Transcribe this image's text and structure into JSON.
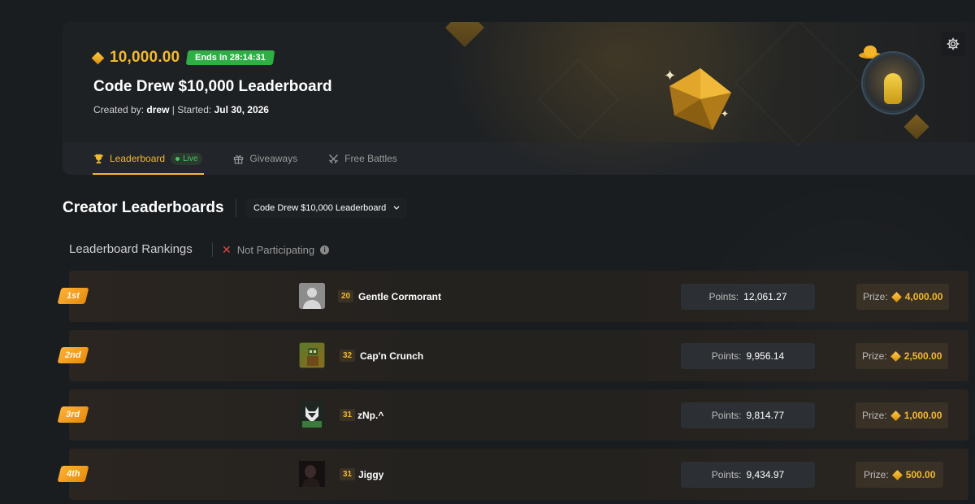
{
  "hero": {
    "prize_amount": "10,000.00",
    "ends_label": "Ends In 28:14:31",
    "title": "Code Drew $10,000 Leaderboard",
    "created_by_label": "Created by:",
    "creator": "drew",
    "separator": "|",
    "started_label": "Started:",
    "started_date": "Jul 30, 2026",
    "accent_color": "#f2b92f",
    "badge_color": "#2fae46"
  },
  "tabs": [
    {
      "label": "Leaderboard",
      "icon": "trophy-icon",
      "badge": "Live",
      "active": true
    },
    {
      "label": "Giveaways",
      "icon": "gift-icon",
      "active": false
    },
    {
      "label": "Free Battles",
      "icon": "swords-icon",
      "active": false
    }
  ],
  "section": {
    "title": "Creator Leaderboards",
    "selected_board": "Code Drew $10,000 Leaderboard"
  },
  "rankings": {
    "heading": "Leaderboard Rankings",
    "status": "Not Participating",
    "points_label": "Points:",
    "prize_label": "Prize:",
    "rows": [
      {
        "rank": "1st",
        "level": "20",
        "name": "Gentle Cormorant",
        "points": "12,061.27",
        "prize": "4,000.00",
        "avatar": "default-avatar"
      },
      {
        "rank": "2nd",
        "level": "32",
        "name": "Cap'n Crunch",
        "points": "9,956.14",
        "prize": "2,500.00",
        "avatar": "green-avatar"
      },
      {
        "rank": "3rd",
        "level": "31",
        "name": "zNp.^",
        "points": "9,814.77",
        "prize": "1,000.00",
        "avatar": "fox-avatar"
      },
      {
        "rank": "4th",
        "level": "31",
        "name": "Jiggy",
        "points": "9,434.97",
        "prize": "500.00",
        "avatar": "dark-avatar"
      }
    ]
  }
}
